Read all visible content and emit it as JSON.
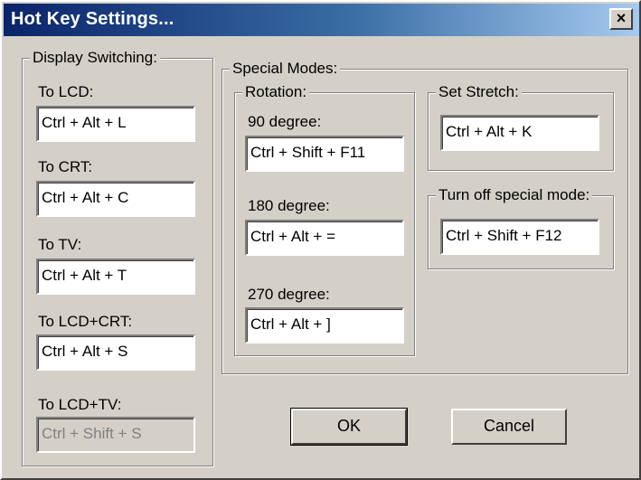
{
  "window": {
    "title": "Hot Key Settings...",
    "close_glyph": "×"
  },
  "display_switching": {
    "legend": "Display Switching:",
    "items": [
      {
        "label": "To LCD:",
        "value": "Ctrl + Alt + L",
        "enabled": true
      },
      {
        "label": "To CRT:",
        "value": "Ctrl + Alt + C",
        "enabled": true
      },
      {
        "label": "To TV:",
        "value": "Ctrl + Alt + T",
        "enabled": true
      },
      {
        "label": "To LCD+CRT:",
        "value": "Ctrl + Alt + S",
        "enabled": true
      },
      {
        "label": "To LCD+TV:",
        "value": "Ctrl + Shift + S",
        "enabled": false
      }
    ]
  },
  "special_modes": {
    "legend": "Special Modes:",
    "rotation": {
      "legend": "Rotation:",
      "items": [
        {
          "label": "90 degree:",
          "value": "Ctrl + Shift + F11"
        },
        {
          "label": "180 degree:",
          "value": "Ctrl + Alt + ="
        },
        {
          "label": "270 degree:",
          "value": "Ctrl + Alt + ]"
        }
      ]
    },
    "set_stretch": {
      "legend": "Set Stretch:",
      "value": "Ctrl + Alt + K"
    },
    "turn_off": {
      "legend": "Turn off special mode:",
      "value": "Ctrl + Shift + F12"
    }
  },
  "buttons": {
    "ok": "OK",
    "cancel": "Cancel"
  }
}
